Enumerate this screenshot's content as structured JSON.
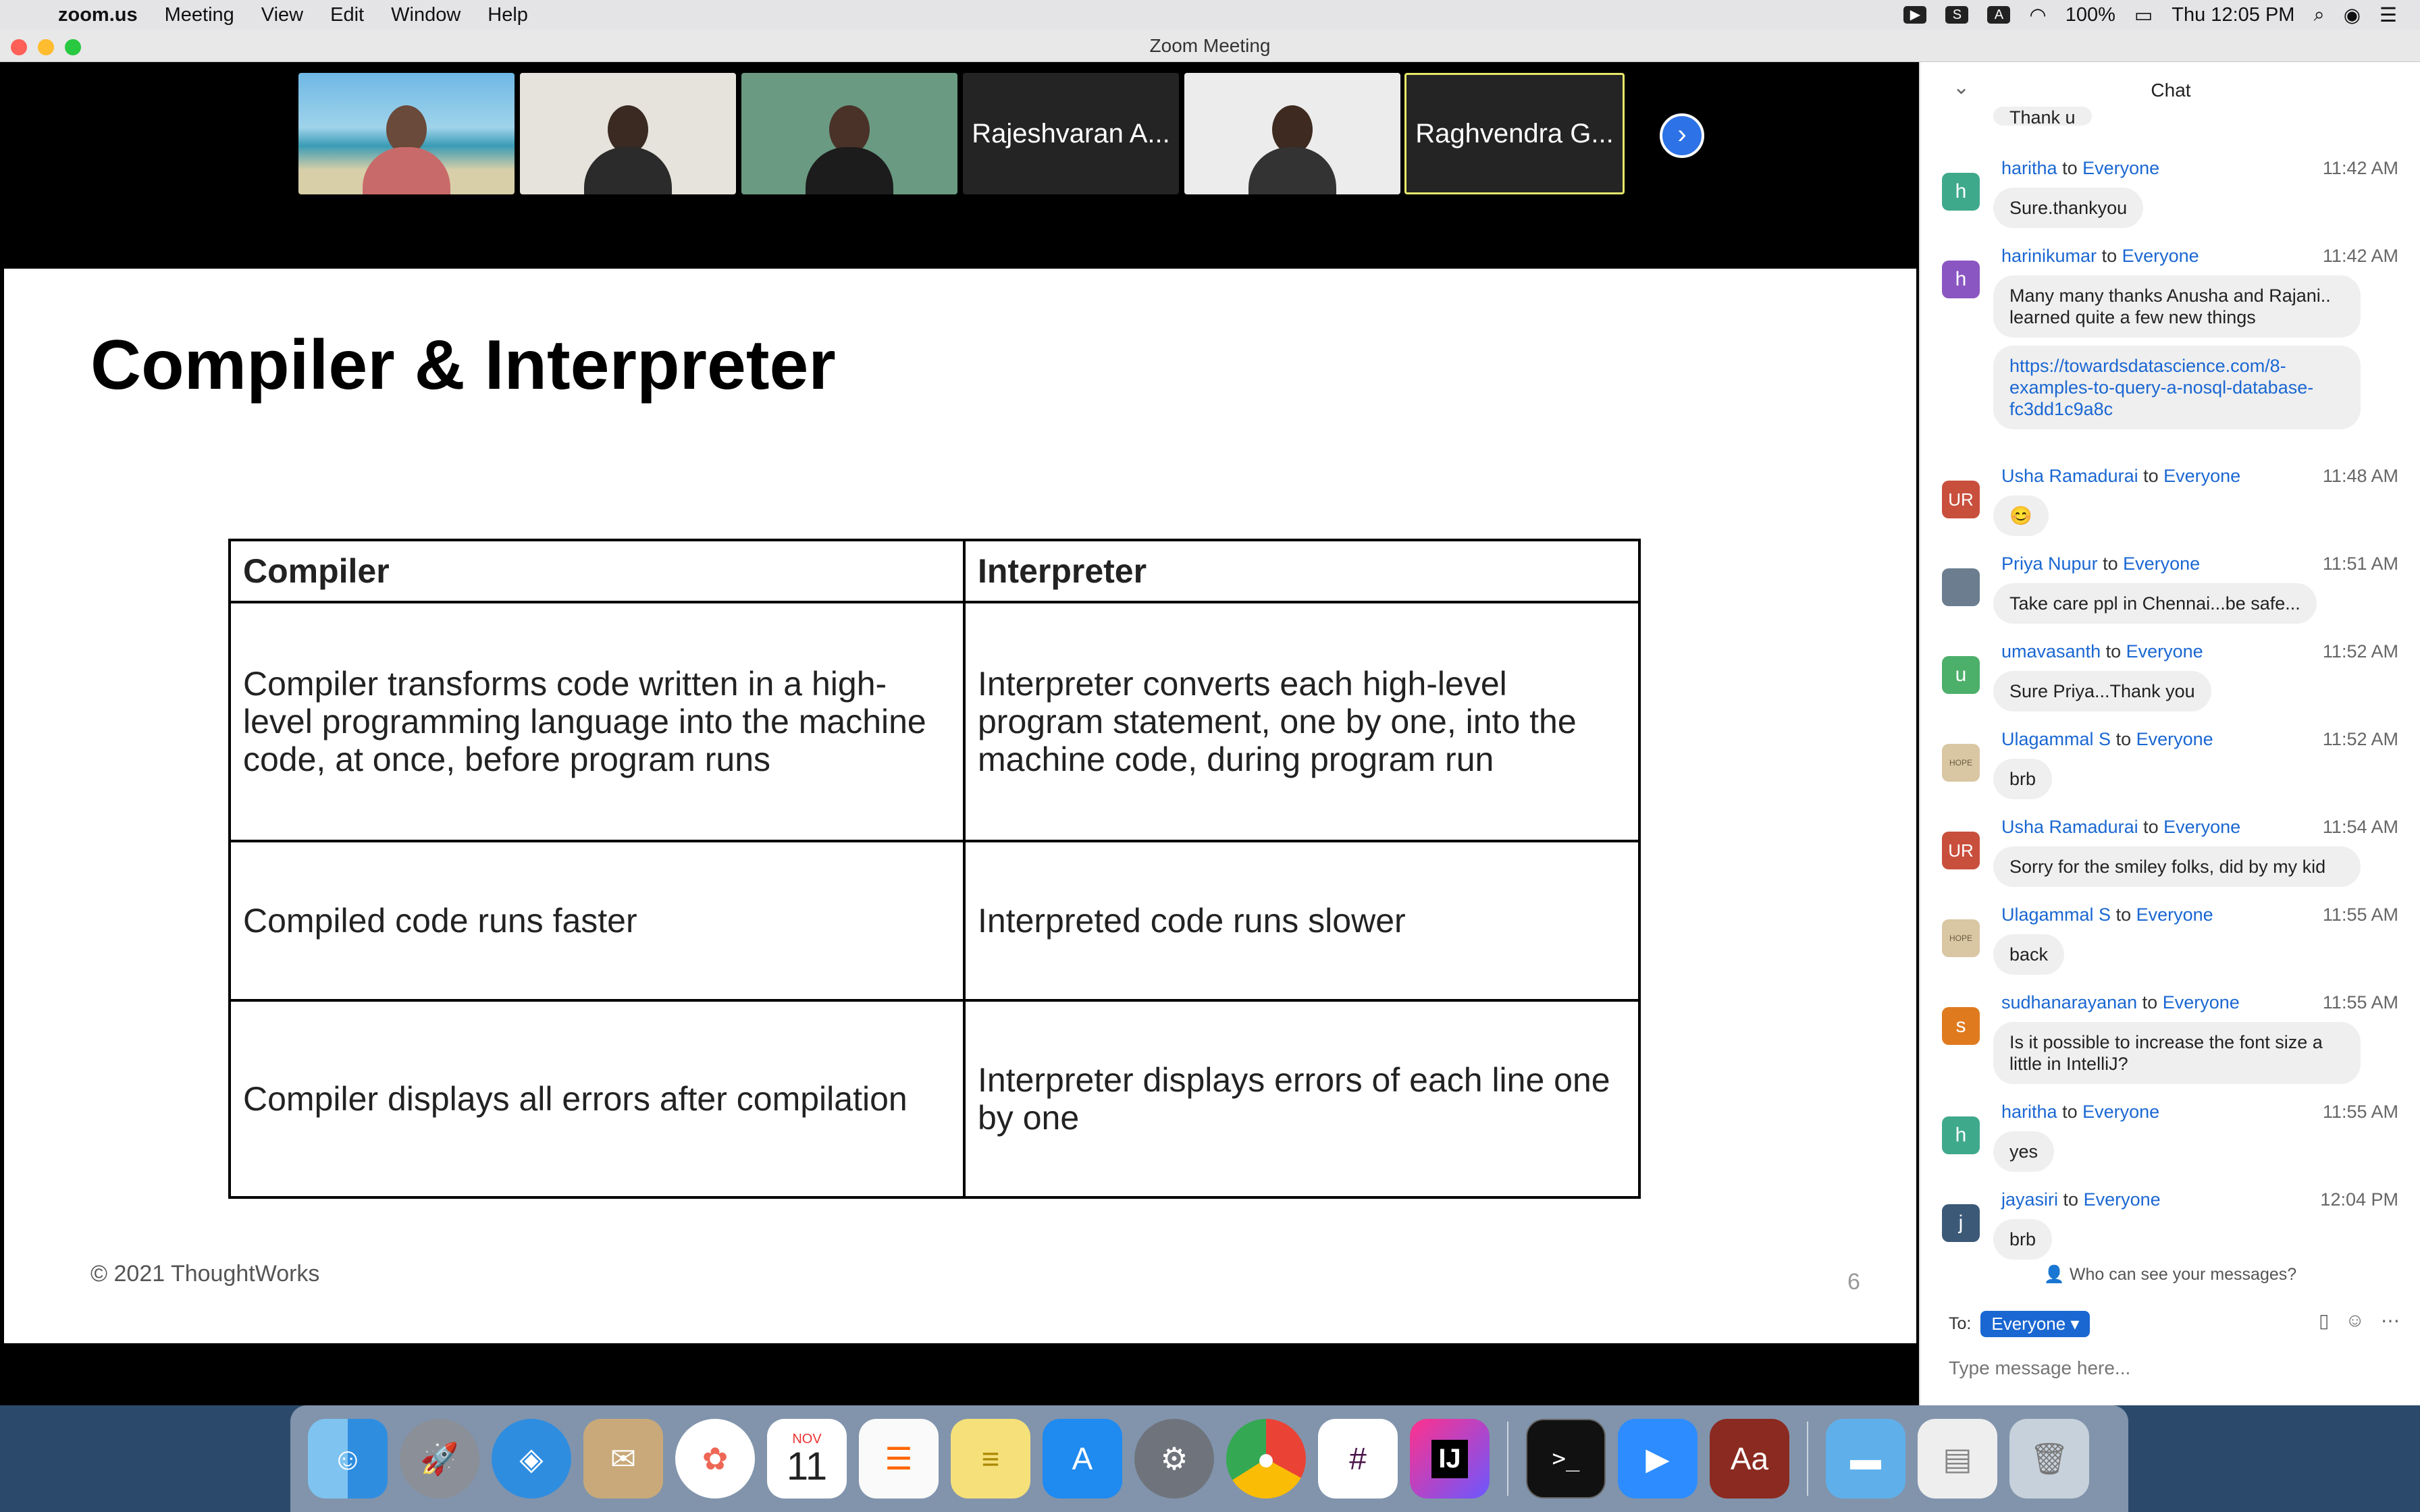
{
  "menubar": {
    "app": "zoom.us",
    "items": [
      "Meeting",
      "View",
      "Edit",
      "Window",
      "Help"
    ],
    "battery": "100%",
    "clock": "Thu 12:05 PM"
  },
  "window": {
    "title": "Zoom Meeting"
  },
  "participants": [
    {
      "name": "",
      "type": "video"
    },
    {
      "name": "",
      "type": "video"
    },
    {
      "name": "",
      "type": "video"
    },
    {
      "name": "Rajeshvaran A...",
      "type": "name"
    },
    {
      "name": "",
      "type": "video"
    },
    {
      "name": "Raghvendra G...",
      "type": "name",
      "active_speaker": true
    }
  ],
  "slide": {
    "title": "Compiler & Interpreter",
    "headers": [
      "Compiler",
      "Interpreter"
    ],
    "rows": [
      [
        "Compiler transforms code written in a high-level programming language into the machine code, at once, before program runs",
        "Interpreter converts each high-level program statement, one by one, into the machine code, during program run"
      ],
      [
        "Compiled code runs faster",
        "Interpreted code runs slower"
      ],
      [
        "Compiler displays all errors after compilation",
        "Interpreter displays errors of each line one by one"
      ]
    ],
    "copyright": "© 2021 ThoughtWorks",
    "page_number": "6"
  },
  "chat": {
    "title": "Chat",
    "partial_top_message": "Thank u",
    "messages": [
      {
        "sender": "haritha",
        "to": "Everyone",
        "time": "11:42 AM",
        "avatar": "h",
        "color": "#3fa98c",
        "text": "Sure.thankyou"
      },
      {
        "sender": "harinikumar",
        "to": "Everyone",
        "time": "11:42 AM",
        "avatar": "h",
        "color": "#8a56c2",
        "text": "Many many thanks Anusha and Rajani.. learned quite a few new things"
      },
      {
        "sender": "",
        "to": "",
        "time": "",
        "avatar": "",
        "color": "",
        "text": "https://towardsdatascience.com/8-examples-to-query-a-nosql-database-fc3dd1c9a8c",
        "link": true
      },
      {
        "sender": "Usha Ramadurai",
        "to": "Everyone",
        "time": "11:48 AM",
        "avatar": "UR",
        "color": "#c94f3d",
        "text": "😊"
      },
      {
        "sender": "Priya Nupur",
        "to": "Everyone",
        "time": "11:51 AM",
        "avatar": "",
        "color": "#6b7d8f",
        "text": "Take care ppl in Chennai...be safe..."
      },
      {
        "sender": "umavasanth",
        "to": "Everyone",
        "time": "11:52 AM",
        "avatar": "u",
        "color": "#4caf6a",
        "text": "Sure Priya...Thank you"
      },
      {
        "sender": "Ulagammal  S",
        "to": "Everyone",
        "time": "11:52 AM",
        "avatar": "HOPE",
        "color": "#d9c6a3",
        "text": "brb"
      },
      {
        "sender": "Usha Ramadurai",
        "to": "Everyone",
        "time": "11:54 AM",
        "avatar": "UR",
        "color": "#c94f3d",
        "text": "Sorry for the smiley folks, did by my kid"
      },
      {
        "sender": "Ulagammal  S",
        "to": "Everyone",
        "time": "11:55 AM",
        "avatar": "HOPE",
        "color": "#d9c6a3",
        "text": "back"
      },
      {
        "sender": "sudhanarayanan",
        "to": "Everyone",
        "time": "11:55 AM",
        "avatar": "s",
        "color": "#e07a1f",
        "text": "Is it possible to increase the font size a little in IntelliJ?"
      },
      {
        "sender": "haritha",
        "to": "Everyone",
        "time": "11:55 AM",
        "avatar": "h",
        "color": "#3fa98c",
        "text": "yes"
      },
      {
        "sender": "jayasiri",
        "to": "Everyone",
        "time": "12:04 PM",
        "avatar": "j",
        "color": "#3c5a78",
        "text": "brb"
      }
    ],
    "to_word": "to",
    "privacy_note": "Who can see your messages?",
    "to_label": "To:",
    "recipient": "Everyone",
    "input_placeholder": "Type message here..."
  },
  "dock": {
    "calendar_month": "NOV",
    "calendar_day": "11",
    "intellij_label": "IJ",
    "dictionary_label": "Aa"
  }
}
